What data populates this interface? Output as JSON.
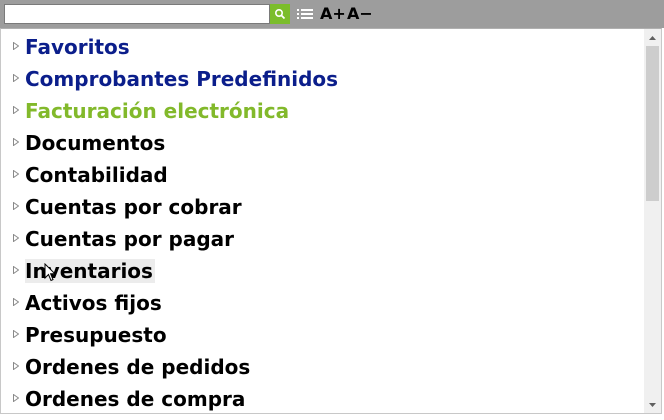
{
  "toolbar": {
    "search_placeholder": "",
    "search_icon": "search-icon",
    "list_icon": "list-icon",
    "font_increase_label": "A+",
    "font_decrease_label": "A−"
  },
  "tree": {
    "items": [
      {
        "label": "Favoritos"
      },
      {
        "label": "Comprobantes Predefinidos"
      },
      {
        "label": "Facturación electrónica"
      },
      {
        "label": "Documentos"
      },
      {
        "label": "Contabilidad"
      },
      {
        "label": "Cuentas por cobrar"
      },
      {
        "label": "Cuentas por pagar"
      },
      {
        "label": "Inventarios"
      },
      {
        "label": "Activos fijos"
      },
      {
        "label": "Presupuesto"
      },
      {
        "label": "Ordenes de pedidos"
      },
      {
        "label": "Ordenes de compra"
      }
    ]
  },
  "colors": {
    "toolbar_bg": "#9d9d9d",
    "search_button": "#7bbd2b",
    "highlight_blue": "#0b1e8b",
    "highlight_green": "#82b92b",
    "hover_bg": "#ececec"
  }
}
